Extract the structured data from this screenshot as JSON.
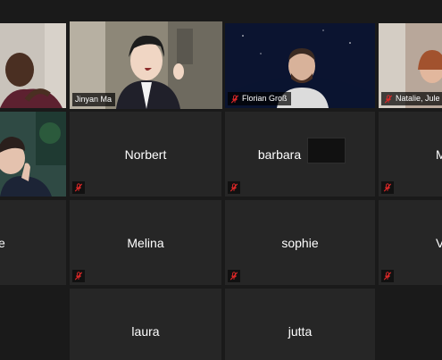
{
  "meeting": {
    "tiles": [
      {
        "name": "",
        "video": true,
        "muted": false
      },
      {
        "name": "Jinyan Ma",
        "video": true,
        "muted": false,
        "active_speaker": true
      },
      {
        "name": "Florian Groß",
        "video": true,
        "muted": true
      },
      {
        "name": "Natalie, Jule",
        "video": true,
        "muted": true
      },
      {
        "name": "",
        "video": true,
        "muted": false
      },
      {
        "name": "Norbert",
        "video": false,
        "muted": true
      },
      {
        "name": "barbara",
        "video": false,
        "muted": true
      },
      {
        "name": "M",
        "video": false,
        "muted": true
      },
      {
        "name": "e",
        "video": false,
        "muted": false
      },
      {
        "name": "Melina",
        "video": false,
        "muted": true
      },
      {
        "name": "sophie",
        "video": false,
        "muted": true
      },
      {
        "name": "V",
        "video": false,
        "muted": true
      },
      {
        "name": "laura",
        "video": false,
        "muted": false
      },
      {
        "name": "jutta",
        "video": false,
        "muted": false
      }
    ]
  },
  "colors": {
    "active_speaker_border": "#e6e052",
    "mute_icon": "#e02828",
    "tile_background": "#262626",
    "grid_background": "#1a1a1a"
  },
  "icons": {
    "muted": "muted-microphone-icon"
  }
}
